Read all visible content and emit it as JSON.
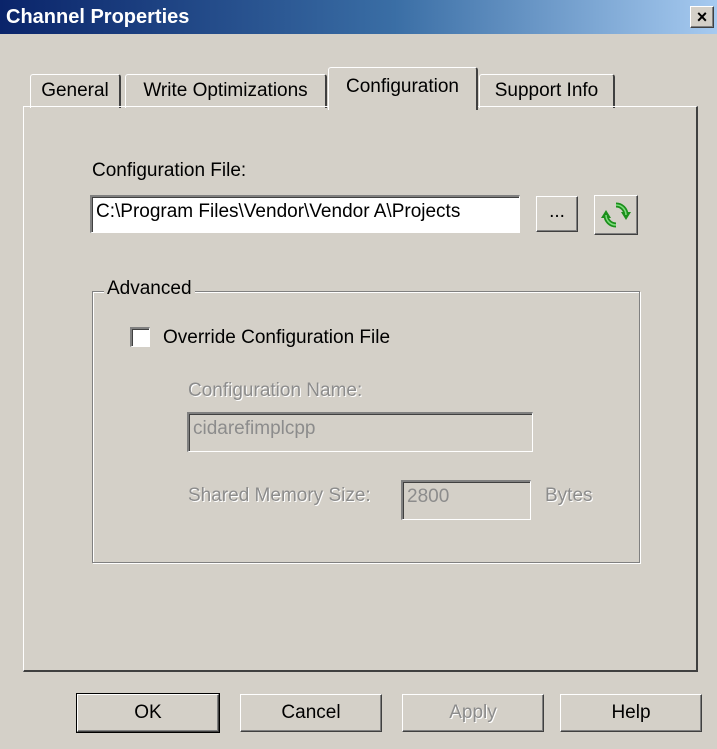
{
  "window": {
    "title": "Channel Properties",
    "close_label": "×"
  },
  "tabs": [
    {
      "label": "General",
      "active": false
    },
    {
      "label": "Write Optimizations",
      "active": false
    },
    {
      "label": "Configuration",
      "active": true
    },
    {
      "label": "Support Info",
      "active": false
    }
  ],
  "configuration": {
    "file_label": "Configuration File:",
    "file_value": "C:\\Program Files\\Vendor\\Vendor A\\Projects",
    "browse_label": "...",
    "reload_icon": "refresh-icon",
    "advanced": {
      "legend": "Advanced",
      "override_label": "Override Configuration File",
      "override_checked": false,
      "name_label": "Configuration Name:",
      "name_value": "cidarefimplcpp",
      "shared_memory_label": "Shared Memory Size:",
      "shared_memory_value": "2800",
      "shared_memory_unit": "Bytes"
    }
  },
  "buttons": {
    "ok": "OK",
    "cancel": "Cancel",
    "apply": "Apply",
    "help": "Help"
  },
  "colors": {
    "title_bar_start": "#0a246a",
    "title_bar_end": "#a6caf0",
    "face": "#d4d0c8",
    "disabled_text": "#8c8c8c"
  }
}
